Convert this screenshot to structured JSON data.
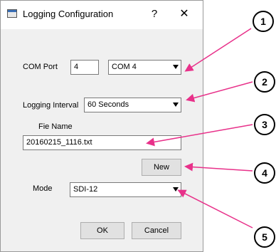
{
  "window": {
    "title": "Logging Configuration",
    "help_glyph": "?",
    "close_glyph": "✕"
  },
  "form": {
    "com_port_label": "COM Port",
    "com_port_value": "4",
    "com_port_select": "COM 4",
    "logging_interval_label": "Logging Interval",
    "logging_interval_select": "60 Seconds",
    "file_name_label": "Fie Name",
    "file_name_value": "20160215_1116.txt",
    "new_button": "New",
    "mode_label": "Mode",
    "mode_select": "SDI-12",
    "ok_button": "OK",
    "cancel_button": "Cancel"
  },
  "callouts": [
    "1",
    "2",
    "3",
    "4",
    "5"
  ],
  "colors": {
    "arrow": "#e8318a"
  }
}
